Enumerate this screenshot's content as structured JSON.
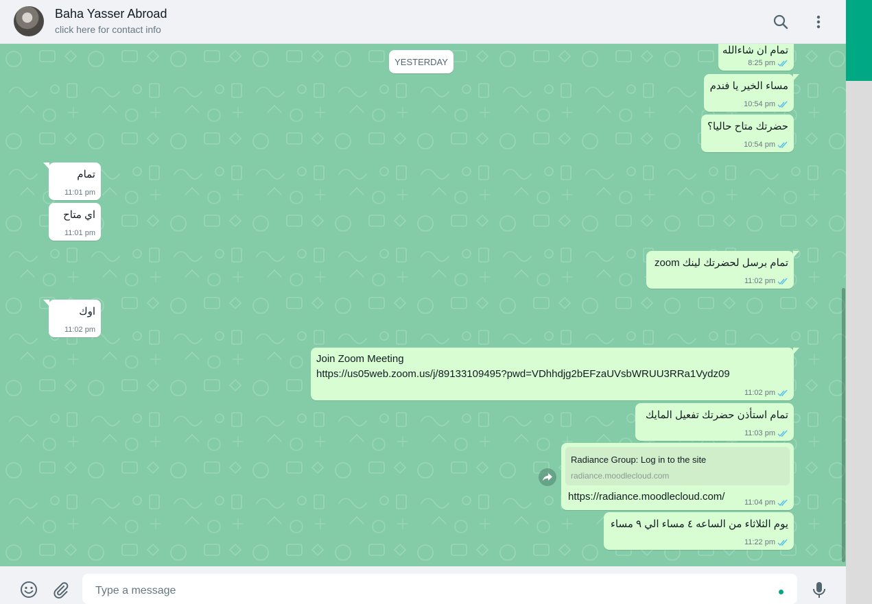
{
  "header": {
    "name": "Baha Yasser Abroad",
    "subtitle": "click here for contact info",
    "search_icon": "search-icon",
    "menu_icon": "kebab-menu-icon"
  },
  "chat": {
    "date_separator": "YESTERDAY",
    "messages": [
      {
        "dir": "out",
        "text": "تمام ان شاءالله",
        "time": "8:25 pm",
        "status": "read"
      },
      {
        "dir": "out",
        "text": "مساء الخير يا فندم",
        "time": "10:54 pm",
        "status": "read"
      },
      {
        "dir": "out",
        "text": "حضرتك متاح حاليا؟",
        "time": "10:54 pm",
        "status": "read"
      },
      {
        "dir": "in",
        "text": "تمام",
        "time": "11:01 pm"
      },
      {
        "dir": "in",
        "text": "اي متاح",
        "time": "11:01 pm"
      },
      {
        "dir": "out",
        "text": "تمام برسل لحضرتك لينك zoom",
        "time": "11:02 pm",
        "status": "read"
      },
      {
        "dir": "in",
        "text": "اوك",
        "time": "11:02 pm"
      },
      {
        "dir": "out",
        "text": "Join Zoom Meeting",
        "link": "https://us05web.zoom.us/j/89133109495?pwd=VDhhdjg2bEFzaUVsbWRUU3RRa1Vydz09",
        "time": "11:02 pm",
        "status": "read"
      },
      {
        "dir": "out",
        "text": "تمام استأذن حضرتك تفعيل المايك",
        "time": "11:03 pm",
        "status": "read"
      },
      {
        "dir": "out",
        "preview_title": "Radiance Group: Log in to the site",
        "preview_domain": "radiance.moodlecloud.com",
        "link": "https://radiance.moodlecloud.com/",
        "time": "11:04 pm",
        "status": "read",
        "forward_icon": "forward-icon"
      },
      {
        "dir": "out",
        "text": "يوم الثلاثاء من الساعه ٤ مساء الي ٩ مساء",
        "time": "11:22 pm",
        "status": "read"
      }
    ]
  },
  "composer": {
    "placeholder": "Type a message",
    "value": "",
    "emoji_icon": "emoji-icon",
    "attach_icon": "paperclip-icon",
    "mic_icon": "microphone-icon"
  },
  "colors": {
    "accent": "#00a884",
    "outgoing_bubble": "#d9fdd3",
    "incoming_bubble": "#ffffff",
    "chat_background": "#84cca8",
    "read_ticks": "#53bdeb",
    "link": "#027eb5"
  }
}
